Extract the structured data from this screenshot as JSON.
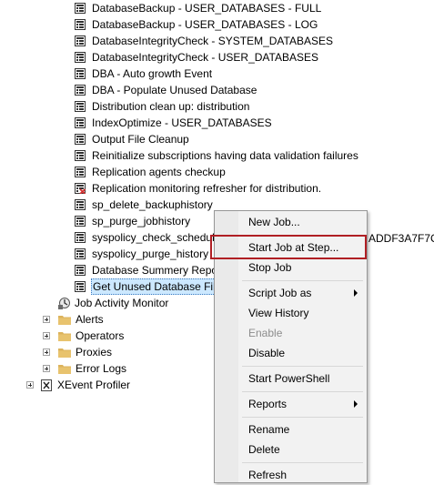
{
  "tree": {
    "jobs": [
      {
        "label": "DatabaseBackup - USER_DATABASES - FULL",
        "status": "normal"
      },
      {
        "label": "DatabaseBackup - USER_DATABASES - LOG",
        "status": "normal"
      },
      {
        "label": "DatabaseIntegrityCheck - SYSTEM_DATABASES",
        "status": "normal"
      },
      {
        "label": "DatabaseIntegrityCheck - USER_DATABASES",
        "status": "normal"
      },
      {
        "label": "DBA - Auto growth Event",
        "status": "normal"
      },
      {
        "label": "DBA - Populate Unused Database",
        "status": "normal"
      },
      {
        "label": "Distribution clean up: distribution",
        "status": "normal"
      },
      {
        "label": "IndexOptimize - USER_DATABASES",
        "status": "normal"
      },
      {
        "label": "Output File Cleanup",
        "status": "normal"
      },
      {
        "label": "Reinitialize subscriptions having data validation failures",
        "status": "normal"
      },
      {
        "label": "Replication agents checkup",
        "status": "normal"
      },
      {
        "label": "Replication monitoring refresher for distribution.",
        "status": "failed"
      },
      {
        "label": "sp_delete_backuphistory",
        "status": "normal"
      },
      {
        "label": "sp_purge_jobhistory",
        "status": "normal"
      },
      {
        "label": "syspolicy_check_schedul",
        "status": "normal"
      },
      {
        "label": "syspolicy_purge_history",
        "status": "normal"
      },
      {
        "label": "Database Summery Repor",
        "status": "normal"
      },
      {
        "label": "Get Unused Database File",
        "status": "normal",
        "selected": true
      }
    ],
    "overflow_text": "ADDF3A7F7C",
    "job_activity_monitor": "Job Activity Monitor",
    "folders": [
      {
        "label": "Alerts"
      },
      {
        "label": "Operators"
      },
      {
        "label": "Proxies"
      },
      {
        "label": "Error Logs"
      }
    ],
    "xevent_profiler": "XEvent Profiler"
  },
  "context_menu": {
    "new_job": "New Job...",
    "start_job_at_step": "Start Job at Step...",
    "stop_job": "Stop Job",
    "script_job_as": "Script Job as",
    "view_history": "View History",
    "enable": "Enable",
    "disable": "Disable",
    "start_powershell": "Start PowerShell",
    "reports": "Reports",
    "rename": "Rename",
    "delete": "Delete",
    "refresh": "Refresh"
  },
  "colors": {
    "selection_bg": "#cce8ff",
    "highlight_border": "#b01f24",
    "folder": "#dcb35c",
    "failed_x": "#d32f2f"
  },
  "icons": {
    "job": "job-icon",
    "job_failed": "job-failed-icon",
    "folder": "folder-icon",
    "monitor": "job-activity-monitor-icon",
    "xevent": "xevent-profiler-icon",
    "submenu": "submenu-arrow-icon",
    "expand": "expand-icon"
  }
}
